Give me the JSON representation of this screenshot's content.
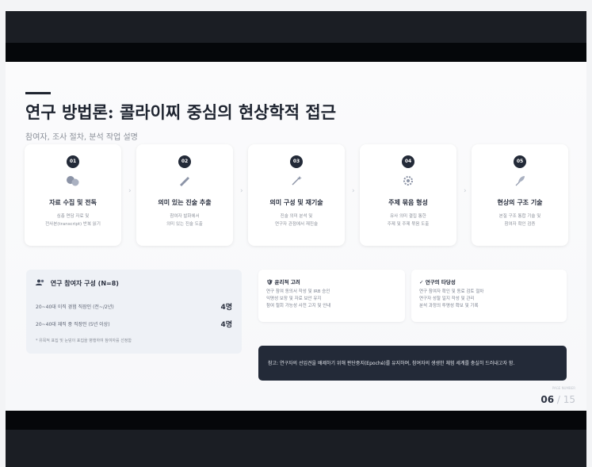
{
  "slide": {
    "title": "연구 방법론: 콜라이찌 중심의 현상학적 접근",
    "subtitle": "참여자, 조사 절차, 분석 작업 설명"
  },
  "steps": [
    {
      "num": "01",
      "icon": "chat-bubbles-icon",
      "title": "자료 수집 및 전독",
      "desc": [
        "심층 면담 자료 및",
        "전사본(transcript) 반복 읽기"
      ]
    },
    {
      "num": "02",
      "icon": "pen-icon",
      "title": "의미 있는 진술 추출",
      "desc": [
        "참여자 발화에서",
        "의미 있는 진술 도출"
      ]
    },
    {
      "num": "03",
      "icon": "magic-wand-icon",
      "title": "의미 구성 및 재기술",
      "desc": [
        "진술 의미 분석 및",
        "연구자 관점에서 재진술"
      ]
    },
    {
      "num": "04",
      "icon": "gear-icon",
      "title": "주제 묶음 형성",
      "desc": [
        "유사 의미 결집 통한",
        "주제 및 주제 묶음 도출"
      ]
    },
    {
      "num": "05",
      "icon": "feather-icon",
      "title": "현상의 구조 기술",
      "desc": [
        "본질 구조 통합 기술 및",
        "참여자 확인 검증"
      ]
    }
  ],
  "participants": {
    "title": "연구 참여자 구성 (N=8)",
    "rows": [
      {
        "label": "20~40대 이직 경험 직장인 (전~/2년)",
        "value": "4명"
      },
      {
        "label": "20~40대 재직 중 직장인 (5년 이상)",
        "value": "4명"
      }
    ],
    "note": "* 유목적 표집 및 눈덩이 표집을 병행하여 참여자를 선정함"
  },
  "info_boxes": [
    {
      "icon": "ethics-icon",
      "title": "윤리적 고려",
      "lines": [
        "연구 참여 동의서 작성 및 IRB 승인",
        "익명성 보장 및 자료 보안 유지",
        "참여 철회 가능성 사전 고지 및 안내"
      ]
    },
    {
      "icon": "trust-icon",
      "title": "연구의 타당성",
      "lines": [
        "연구 참여자 확인 및 동료 검토 절차",
        "연구자 성찰 일지 작성 및 관리",
        "분석 과정의 투명성 확보 및 기록"
      ]
    }
  ],
  "banner": {
    "text": "참고: 연구자의 선입견을 배제하기 위해 판단중지(Epoché)를 유지하며, 참여자의 생생한 체험 세계를 충실히 드러내고자 함."
  },
  "page": {
    "current": "06",
    "separator": " / ",
    "total": "15",
    "caption": "PAGE NUMBER"
  }
}
